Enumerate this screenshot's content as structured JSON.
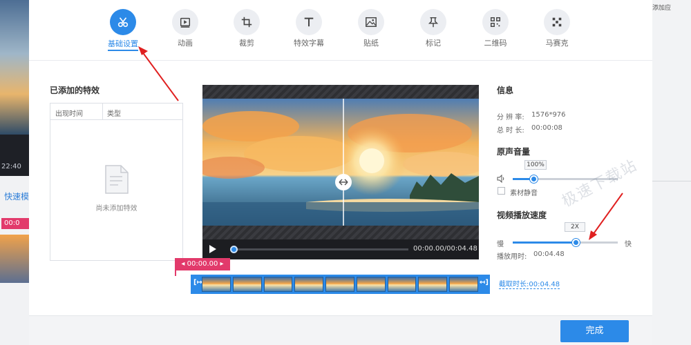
{
  "background": {
    "left_time": "22:40",
    "left_link": "快速模",
    "left_tag": "00:0",
    "right_text": "添加应"
  },
  "toolbar": {
    "items": [
      {
        "label": "基础设置",
        "icon": "scissors-icon",
        "active": true
      },
      {
        "label": "动画",
        "icon": "play-frame-icon",
        "active": false
      },
      {
        "label": "裁剪",
        "icon": "crop-icon",
        "active": false
      },
      {
        "label": "特效字幕",
        "icon": "text-t-icon",
        "active": false
      },
      {
        "label": "贴纸",
        "icon": "image-icon",
        "active": false
      },
      {
        "label": "标记",
        "icon": "pin-icon",
        "active": false
      },
      {
        "label": "二维码",
        "icon": "qr-icon",
        "active": false
      },
      {
        "label": "马赛克",
        "icon": "mosaic-icon",
        "active": false
      }
    ]
  },
  "effects": {
    "title": "已添加的特效",
    "col_time": "出现时间",
    "col_type": "类型",
    "empty_text": "尚未添加特效"
  },
  "player": {
    "time": "00:00.00/00:04.48",
    "progress": 0.0
  },
  "info": {
    "title": "信息",
    "resolution_label": "分 辨 率:",
    "resolution_value": "1576*976",
    "duration_label": "总 时 长:",
    "duration_value": "00:00:08"
  },
  "volume": {
    "title": "原声音量",
    "value": "100%",
    "level": 0.2,
    "mute_label": "素材静音"
  },
  "speed": {
    "title": "视频播放速度",
    "value": "2X",
    "level": 0.6,
    "slow_label": "慢",
    "fast_label": "快",
    "play_duration_label": "播放用时:",
    "play_duration_value": "00:04.48"
  },
  "timeline": {
    "marker_time": "00:00.00",
    "capture_label": "截取时长:00:04.48"
  },
  "footer": {
    "done_label": "完成"
  },
  "watermark": "极速下载站",
  "colors": {
    "accent": "#2c8ae8",
    "marker": "#e23a6b",
    "arrow": "#e02020"
  }
}
